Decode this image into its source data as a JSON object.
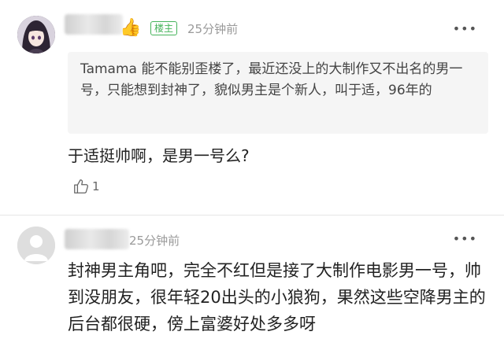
{
  "comments": [
    {
      "owner_badge": "楼主",
      "time": "25分钟前",
      "quote": "Tamama 能不能别歪楼了，最近还没上的大制作又不出名的男一号，只能想到封神了，貌似男主是个新人，叫于适，96年的",
      "text": "于适挺帅啊，是男一号么?",
      "likes": "1"
    },
    {
      "time": "25分钟前",
      "text": "封神男主角吧，完全不红但是接了大制作电影男一号，帅到没朋友，很年轻20出头的小狼狗，果然这些空降男主的后台都很硬，傍上富婆好处多多呀"
    }
  ],
  "icons": [
    "thumbs-up-emoji-icon",
    "more-dots-icon",
    "like-icon",
    "default-avatar-icon"
  ],
  "colors": {
    "badge_green": "#45b35a",
    "time_gray": "#9a9a9a",
    "quote_bg": "#f5f5f5"
  }
}
